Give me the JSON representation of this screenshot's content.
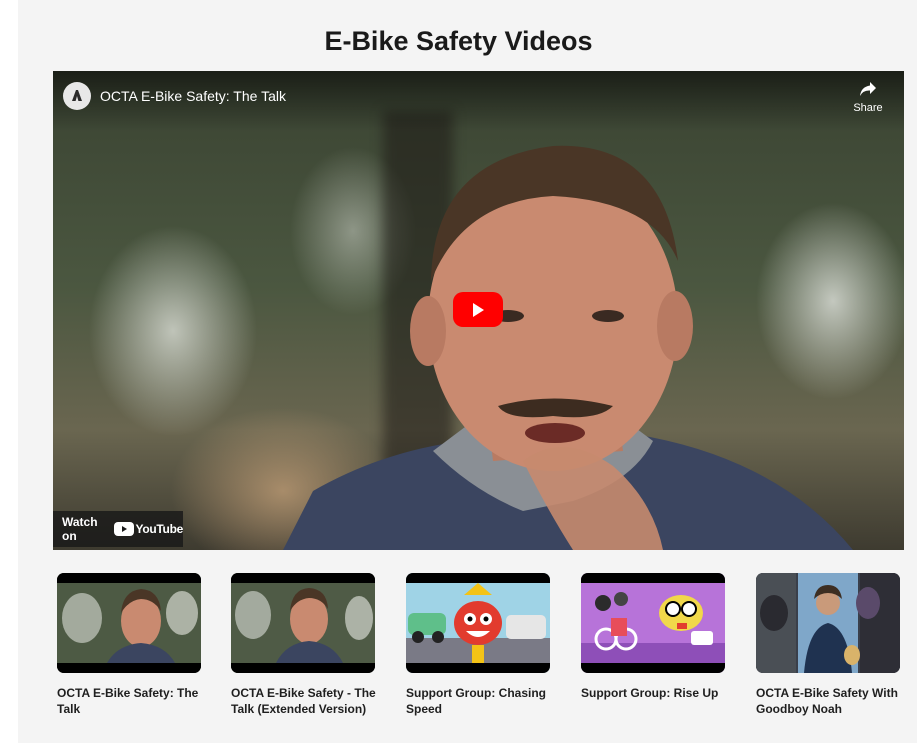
{
  "page": {
    "title": "E-Bike Safety Videos"
  },
  "player": {
    "video_title": "OCTA E-Bike Safety: The Talk",
    "share_label": "Share",
    "watch_on_label": "Watch on",
    "youtube_label": "YouTube",
    "channel_logo_text": "OCTA",
    "icons": {
      "play": "play-icon",
      "share": "share-icon",
      "logo": "octa-logo"
    },
    "accent_color": "#ff0000"
  },
  "playlist": [
    {
      "title": "OCTA E-Bike Safety: The Talk"
    },
    {
      "title": "OCTA E-Bike Safety - The Talk (Extended Version)"
    },
    {
      "title": "Support Group: Chasing Speed"
    },
    {
      "title": "Support Group: Rise Up"
    },
    {
      "title": "OCTA E-Bike Safety With Goodboy Noah"
    }
  ]
}
